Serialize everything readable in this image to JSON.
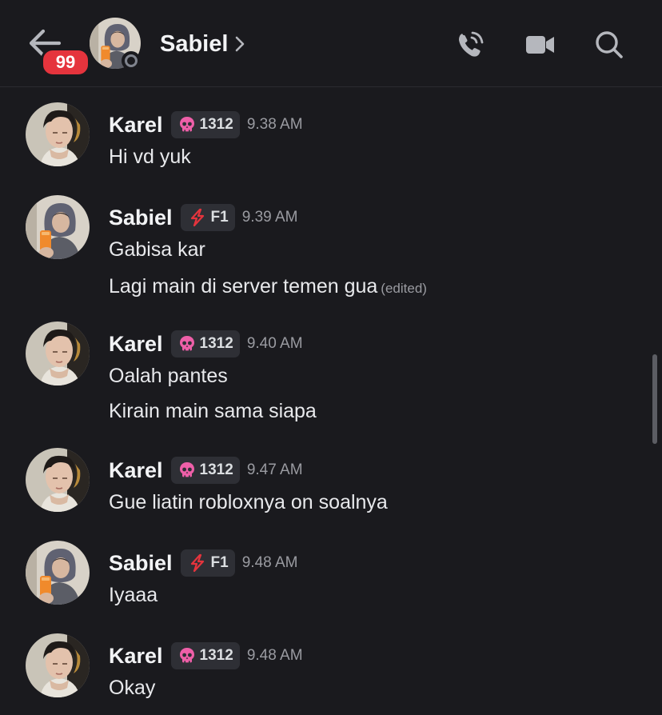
{
  "header": {
    "back_icon": "arrow-left-icon",
    "unread_count": "99",
    "channel_name": "Sabiel",
    "status": "offline",
    "icons": [
      "phone-call-icon",
      "video-camera-icon",
      "search-icon"
    ]
  },
  "tags": {
    "karel": {
      "icon": "skull-icon",
      "label": "1312",
      "color": "#ee5fa8"
    },
    "sabiel": {
      "icon": "lightning-icon",
      "label": "F1",
      "color": "#e5343d"
    }
  },
  "messages": [
    {
      "author": "Karel",
      "tag": "1312",
      "time": "9.38 AM",
      "lines": [
        "Hi vd yuk"
      ]
    },
    {
      "author": "Sabiel",
      "tag": "F1",
      "time": "9.39 AM",
      "lines": [
        "Gabisa kar",
        "Lagi main di server temen gua"
      ],
      "edited": "(edited)"
    },
    {
      "author": "Karel",
      "tag": "1312",
      "time": "9.40 AM",
      "lines": [
        "Oalah pantes",
        "Kirain main sama siapa"
      ]
    },
    {
      "author": "Karel",
      "tag": "1312",
      "time": "9.47 AM",
      "lines": [
        "Gue liatin robloxnya on soalnya"
      ]
    },
    {
      "author": "Sabiel",
      "tag": "F1",
      "time": "9.48 AM",
      "lines": [
        "Iyaaa"
      ]
    },
    {
      "author": "Karel",
      "tag": "1312",
      "time": "9.48 AM",
      "lines": [
        "Okay"
      ]
    }
  ],
  "colors": {
    "background": "#1a1a1e",
    "badge": "#e5343d",
    "tag_bg": "#2e2f35",
    "muted_text": "#9a9ba1"
  }
}
